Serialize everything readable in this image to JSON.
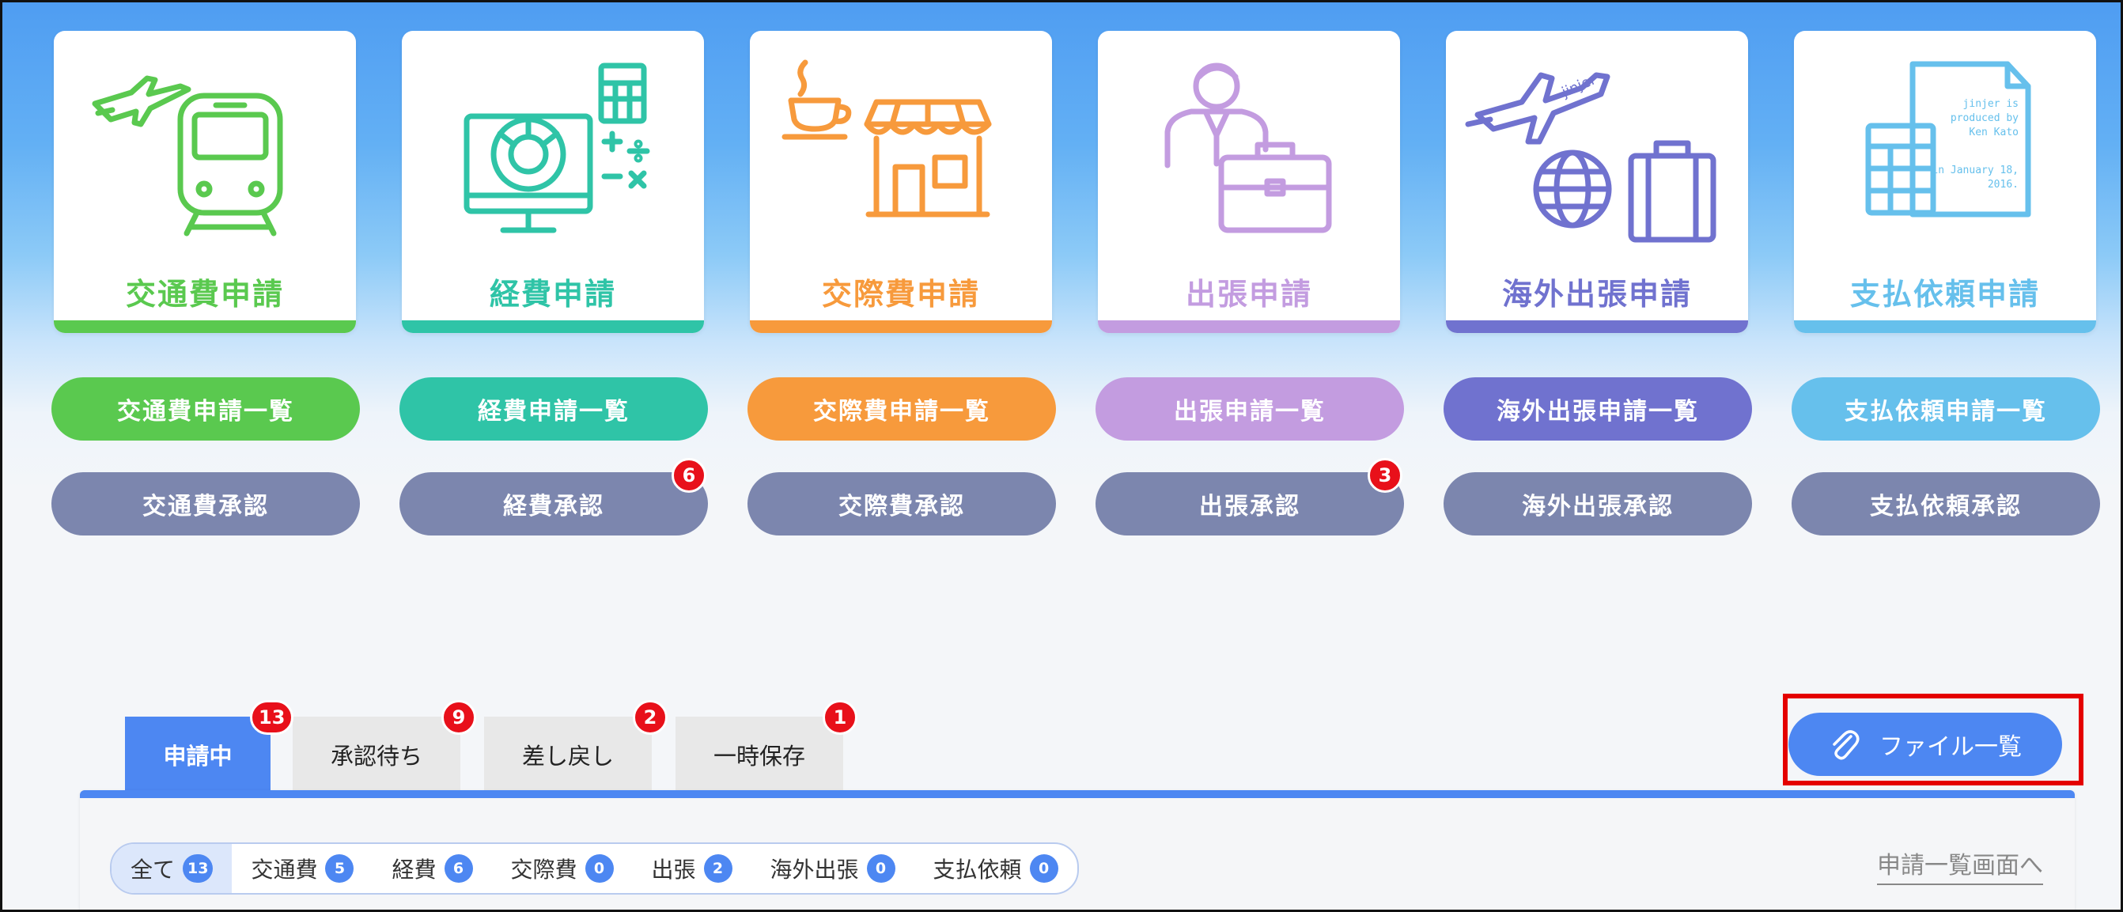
{
  "colors": {
    "transport": "#5ac94f",
    "expense": "#2fc4a7",
    "entertainment": "#f79a3c",
    "trip": "#c39ce0",
    "overseas": "#7072cf",
    "payment": "#66c0ec",
    "approve": "#7c86ae",
    "accent": "#4d87f2",
    "badge": "#e8101a",
    "highlight": "#e40000"
  },
  "cards": [
    {
      "title": "交通費申請",
      "icon": "train-plane-icon",
      "list_label": "交通費申請一覧",
      "approve_label": "交通費承認",
      "approve_badge": ""
    },
    {
      "title": "経費申請",
      "icon": "monitor-calculator-icon",
      "list_label": "経費申請一覧",
      "approve_label": "経費承認",
      "approve_badge": "6"
    },
    {
      "title": "交際費申請",
      "icon": "cafe-shop-icon",
      "list_label": "交際費申請一覧",
      "approve_label": "交際費承認",
      "approve_badge": ""
    },
    {
      "title": "出張申請",
      "icon": "businessman-briefcase-icon",
      "list_label": "出張申請一覧",
      "approve_label": "出張承認",
      "approve_badge": "3"
    },
    {
      "title": "海外出張申請",
      "icon": "plane-globe-suitcase-icon",
      "list_label": "海外出張申請一覧",
      "approve_label": "海外出張承認",
      "approve_badge": ""
    },
    {
      "title": "支払依頼申請",
      "icon": "invoice-calculator-icon",
      "list_label": "支払依頼申請一覧",
      "approve_label": "支払依頼承認",
      "approve_badge": ""
    }
  ],
  "art_text": {
    "overseas_tag": "jinjer",
    "invoice_lines": [
      "jinjer is",
      "produced by",
      "Ken Kato",
      "in January 18,",
      "2016."
    ]
  },
  "tabs": [
    {
      "label": "申請中",
      "badge": "13",
      "active": true
    },
    {
      "label": "承認待ち",
      "badge": "9",
      "active": false
    },
    {
      "label": "差し戻し",
      "badge": "2",
      "active": false
    },
    {
      "label": "一時保存",
      "badge": "1",
      "active": false
    }
  ],
  "file_button": {
    "label": "ファイル一覧",
    "icon": "paperclip-icon"
  },
  "filters": [
    {
      "label": "全て",
      "count": "13",
      "selected": true
    },
    {
      "label": "交通費",
      "count": "5",
      "selected": false
    },
    {
      "label": "経費",
      "count": "6",
      "selected": false
    },
    {
      "label": "交際費",
      "count": "0",
      "selected": false
    },
    {
      "label": "出張",
      "count": "2",
      "selected": false
    },
    {
      "label": "海外出張",
      "count": "0",
      "selected": false
    },
    {
      "label": "支払依頼",
      "count": "0",
      "selected": false
    }
  ],
  "list_link": "申請一覧画面へ"
}
